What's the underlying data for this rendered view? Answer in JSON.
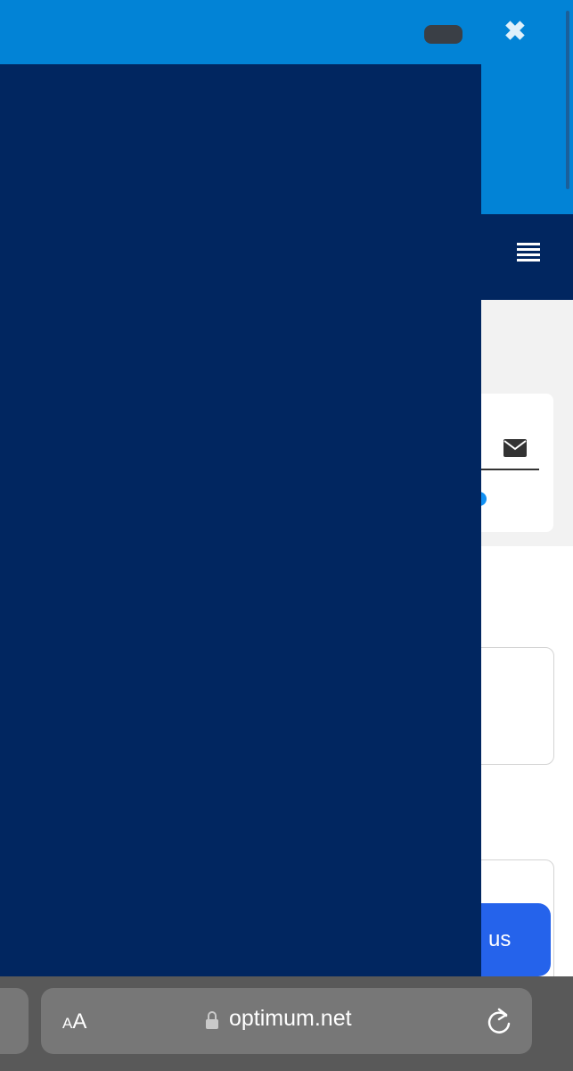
{
  "header": {
    "close_glyph": "✖"
  },
  "nav": {
    "menu_icon": "hamburger-menu-icon"
  },
  "contact_card": {
    "icon": "envelope-icon"
  },
  "chat_button": {
    "label": "h us"
  },
  "browser": {
    "text_size_label_small": "A",
    "text_size_label_large": "A",
    "url": "optimum.net",
    "lock_icon": "lock-icon",
    "reload_icon": "reload-icon"
  },
  "colors": {
    "top_bar": "#0283d6",
    "drawer": "#012660",
    "nav": "#012660",
    "chat_button": "#2563eb",
    "safari_bar": "#595959"
  }
}
